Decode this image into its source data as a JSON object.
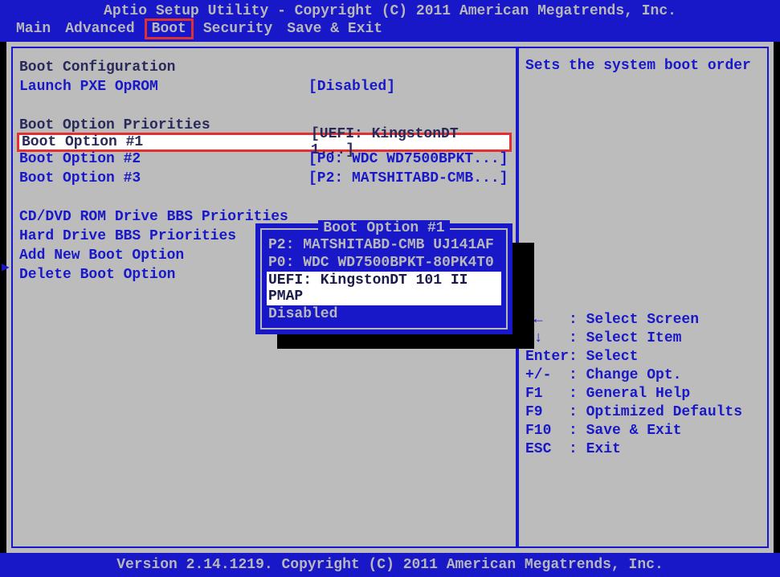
{
  "header": {
    "title": "Aptio Setup Utility - Copyright (C) 2011 American Megatrends, Inc.",
    "tabs": [
      "Main",
      "Advanced",
      "Boot",
      "Security",
      "Save & Exit"
    ]
  },
  "left": {
    "section_boot_config": "Boot Configuration",
    "launch_pxe_label": "Launch PXE OpROM",
    "launch_pxe_value": "[Disabled]",
    "section_priorities": "Boot Option Priorities",
    "opt1_label": "Boot Option #1",
    "opt1_value": "[UEFI: KingstonDT 1...]",
    "opt2_label": "Boot Option #2",
    "opt2_value": "[P0: WDC WD7500BPKT...]",
    "opt3_label": "Boot Option #3",
    "opt3_value": "[P2: MATSHITABD-CMB...]",
    "cd_dvd": "CD/DVD ROM Drive BBS Priorities",
    "hdd": "Hard Drive BBS Priorities",
    "add_new": "Add New Boot Option",
    "delete": "Delete Boot Option"
  },
  "right": {
    "help_text": "Sets the system boot order",
    "keys": [
      {
        "k": "→←",
        "d": ": Select Screen"
      },
      {
        "k": "↑↓",
        "d": ": Select Item"
      },
      {
        "k": "Enter",
        "d": ": Select"
      },
      {
        "k": "+/-",
        "d": ": Change Opt."
      },
      {
        "k": "F1",
        "d": ": General Help"
      },
      {
        "k": "F9",
        "d": ": Optimized Defaults"
      },
      {
        "k": "F10",
        "d": ": Save & Exit"
      },
      {
        "k": "ESC",
        "d": ": Exit"
      }
    ]
  },
  "popup": {
    "title": "Boot Option #1",
    "items": [
      "P2: MATSHITABD-CMB UJ141AF",
      "P0: WDC WD7500BPKT-80PK4T0",
      "UEFI: KingstonDT 101 II PMAP",
      "Disabled"
    ],
    "selected_index": 2
  },
  "footer": "Version 2.14.1219. Copyright (C) 2011 American Megatrends, Inc."
}
